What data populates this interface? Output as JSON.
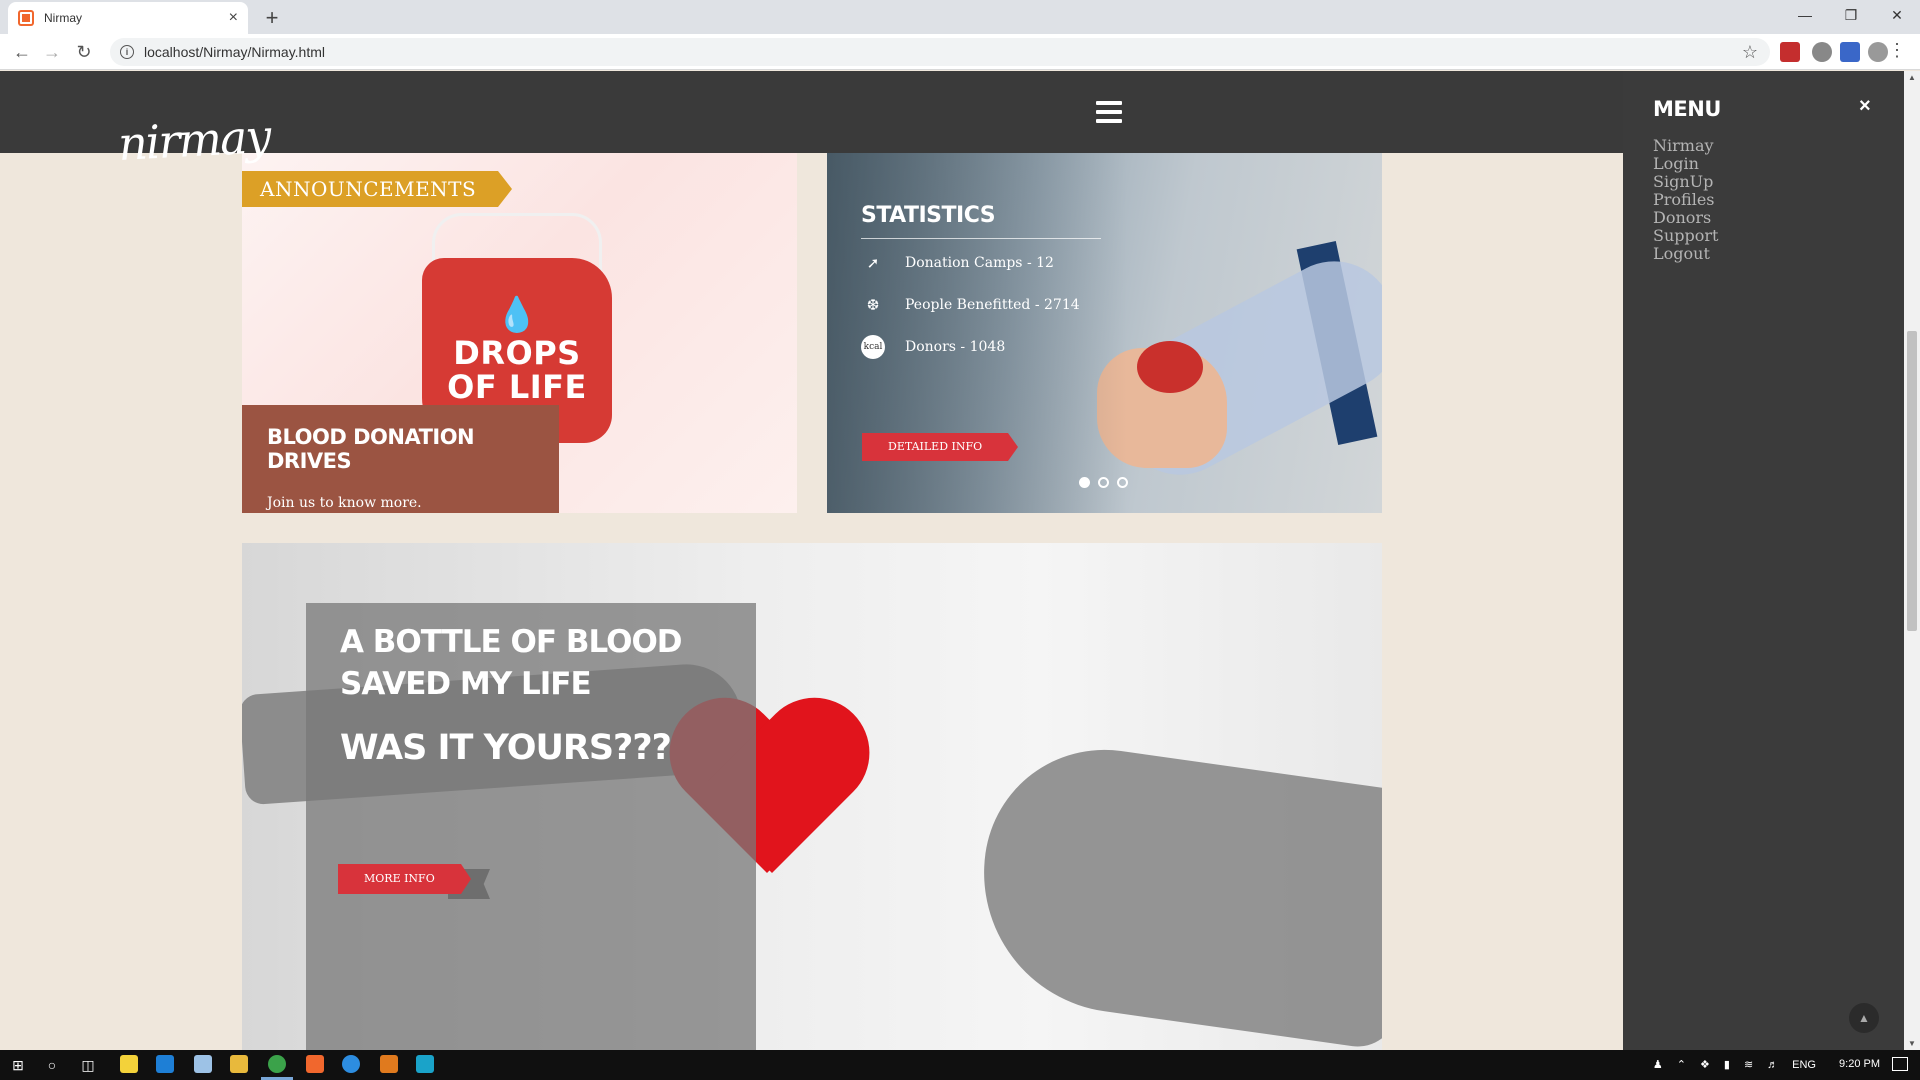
{
  "browser": {
    "tab_title": "Nirmay",
    "url": "localhost/Nirmay/Nirmay.html"
  },
  "site": {
    "logo_text": "nirmay"
  },
  "announcements": {
    "tag": "ANNOUNCEMENTS",
    "badge_text": "DROPS OF LIFE",
    "card_title": "BLOOD DONATION DRIVES",
    "card_sub": "Join us to know more."
  },
  "statistics": {
    "title": "STATISTICS",
    "rows": [
      {
        "icon": "syringe-icon",
        "text": "Donation Camps - 12"
      },
      {
        "icon": "wheat-icon",
        "text": "People Benefitted - 2714"
      },
      {
        "icon": "kcal-icon",
        "icon_text": "kcal",
        "text": "Donors - 1048"
      }
    ],
    "button_label": "DETAILED INFO",
    "slide_count": 3,
    "active_slide": 0
  },
  "hero": {
    "title": "A BOTTLE OF BLOOD SAVED MY LIFE",
    "question": "WAS IT YOURS???",
    "button_label": "MORE INFO"
  },
  "side_menu": {
    "title": "MENU",
    "close": "×",
    "items": [
      "Nirmay",
      "Login",
      "SignUp",
      "Profiles",
      "Donors",
      "Support",
      "Logout"
    ]
  },
  "taskbar": {
    "language": "ENG",
    "time": "9:20 PM"
  },
  "colors": {
    "page_bg": "#efe7dc",
    "header_bg": "#3a3a3a",
    "accent_red": "#d8333b",
    "tag_gold": "#dca026",
    "card_brown": "#9b5442"
  }
}
